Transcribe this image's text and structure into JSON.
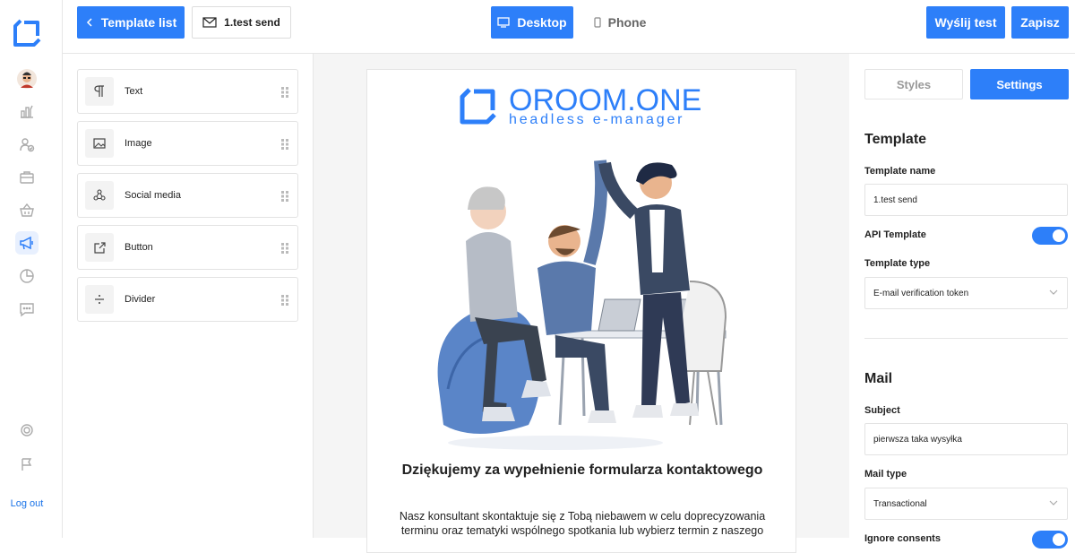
{
  "rail": {
    "icons": [
      "logo-icon",
      "avatar",
      "chart-icon",
      "users-icon",
      "briefcase-icon",
      "basket-icon",
      "megaphone-icon",
      "pie-chart-icon",
      "chat-icon",
      "lifebuoy-icon",
      "flag-icon"
    ],
    "logout_label": "Log out"
  },
  "topbar": {
    "template_list_label": "Template list",
    "template_name_label": "1.test send",
    "desktop_label": "Desktop",
    "phone_label": "Phone",
    "send_test_label": "Wyślij test",
    "save_label": "Zapisz"
  },
  "blocks": [
    {
      "label": "Text",
      "icon": "pilcrow-icon"
    },
    {
      "label": "Image",
      "icon": "image-icon"
    },
    {
      "label": "Social media",
      "icon": "share-icon"
    },
    {
      "label": "Button",
      "icon": "external-link-icon"
    },
    {
      "label": "Divider",
      "icon": "divide-icon"
    }
  ],
  "email": {
    "brand_title": "OROOM.ONE",
    "brand_subtitle": "headless e-manager",
    "heading": "Dziękujemy za wypełnienie formularza kontaktowego",
    "body": "Nasz konsultant skontaktuje się z Tobą niebawem w celu doprecyzowania terminu oraz tematyki wspólnego spotkania lub wybierz termin z naszego"
  },
  "settings": {
    "tabs": [
      {
        "label": "Styles",
        "active": false
      },
      {
        "label": "Settings",
        "active": true
      }
    ],
    "template_section": "Template",
    "template_name_label": "Template name",
    "template_name_value": "1.test send",
    "api_template_label": "API Template",
    "api_template_on": true,
    "template_type_label": "Template type",
    "template_type_value": "E-mail verification token",
    "mail_section": "Mail",
    "subject_label": "Subject",
    "subject_value": "pierwsza taka wysyłka",
    "mail_type_label": "Mail type",
    "mail_type_value": "Transactional",
    "ignore_consents_label": "Ignore consents",
    "ignore_consents_on": true
  },
  "colors": {
    "accent": "#2d7ff9",
    "border": "#e3e3e3",
    "canvas_bg": "#f5f5f5"
  }
}
